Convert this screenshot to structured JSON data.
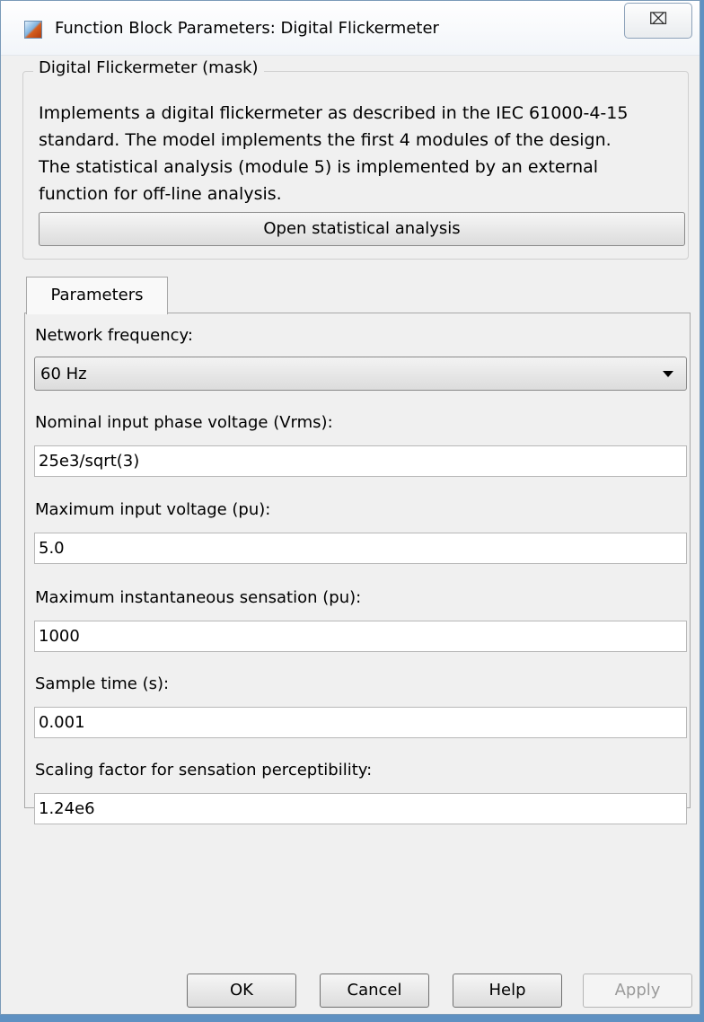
{
  "window": {
    "title": "Function Block Parameters: Digital Flickermeter",
    "close_glyph": "⌧"
  },
  "mask": {
    "legend": "Digital Flickermeter (mask)",
    "description_lines": [
      "Implements a digital flickermeter as described in the IEC 61000-4-15",
      "standard. The model implements the first 4 modules of the design.",
      "The statistical analysis (module 5) is implemented by an external",
      "function for off-line analysis."
    ],
    "open_button": "Open statistical analysis"
  },
  "tabs": [
    {
      "label": "Parameters"
    }
  ],
  "parameters": {
    "network_frequency": {
      "label": "Network  frequency:",
      "value": "60 Hz"
    },
    "nominal_voltage": {
      "label": "Nominal input phase voltage (Vrms):",
      "value": "25e3/sqrt(3)"
    },
    "max_input_voltage": {
      "label": "Maximum input voltage (pu):",
      "value": "5.0"
    },
    "max_sensation": {
      "label": "Maximum instantaneous sensation (pu):",
      "value": "1000"
    },
    "sample_time": {
      "label": "Sample time (s):",
      "value": "0.001"
    },
    "scaling_factor": {
      "label": "Scaling factor for sensation perceptibility:",
      "value": "1.24e6"
    }
  },
  "buttons": {
    "ok": "OK",
    "cancel": "Cancel",
    "help": "Help",
    "apply": "Apply"
  },
  "icons": {
    "app": "simulink-block-icon",
    "close": "close-icon",
    "dropdown": "chevron-down-icon"
  },
  "colors": {
    "window_bg": "#f0f0f0",
    "desktop": "#5f91c2",
    "disabled_text": "#9a9a9a"
  }
}
